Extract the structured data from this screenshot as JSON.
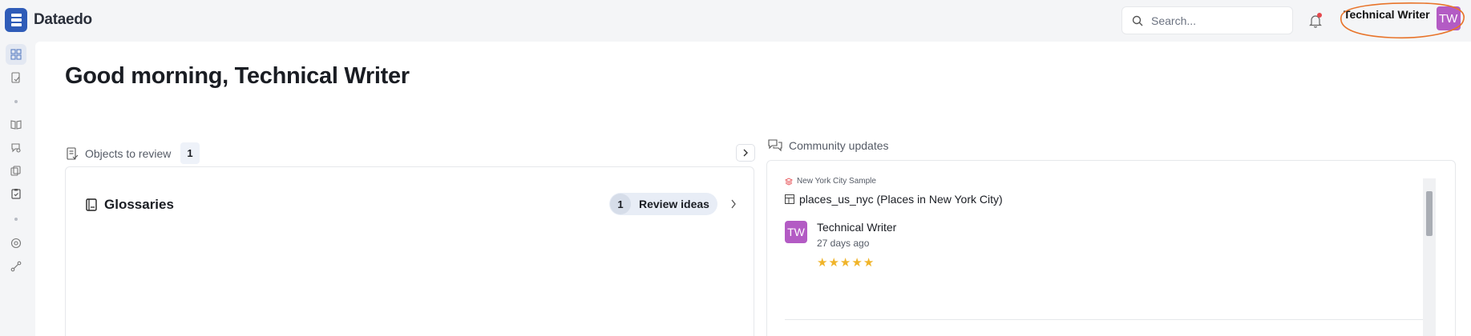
{
  "app": {
    "name": "Dataedo"
  },
  "search": {
    "placeholder": "Search..."
  },
  "user": {
    "name": "Technical Writer",
    "initials": "TW"
  },
  "greeting": "Good morning, Technical Writer",
  "objects_to_review": {
    "label": "Objects to review",
    "count": "1",
    "card": {
      "title": "Glossaries",
      "pill_count": "1",
      "pill_label": "Review ideas"
    }
  },
  "community_updates": {
    "label": "Community updates",
    "items": [
      {
        "source": "New York City Sample",
        "object": "places_us_nyc (Places in New York City)",
        "author": "Technical Writer",
        "author_initials": "TW",
        "time": "27 days ago",
        "rating": 5
      }
    ]
  },
  "colors": {
    "accent": "#2f5cb8",
    "avatar": "#b35bc4",
    "star": "#f0b429",
    "annotation": "#e8742a"
  },
  "icons": {
    "sidebar": [
      "dashboard-icon",
      "review-icon",
      "dot",
      "book-icon",
      "search-community-icon",
      "copy-icon",
      "clipboard-icon",
      "dot",
      "settings-icon",
      "connections-icon"
    ]
  }
}
